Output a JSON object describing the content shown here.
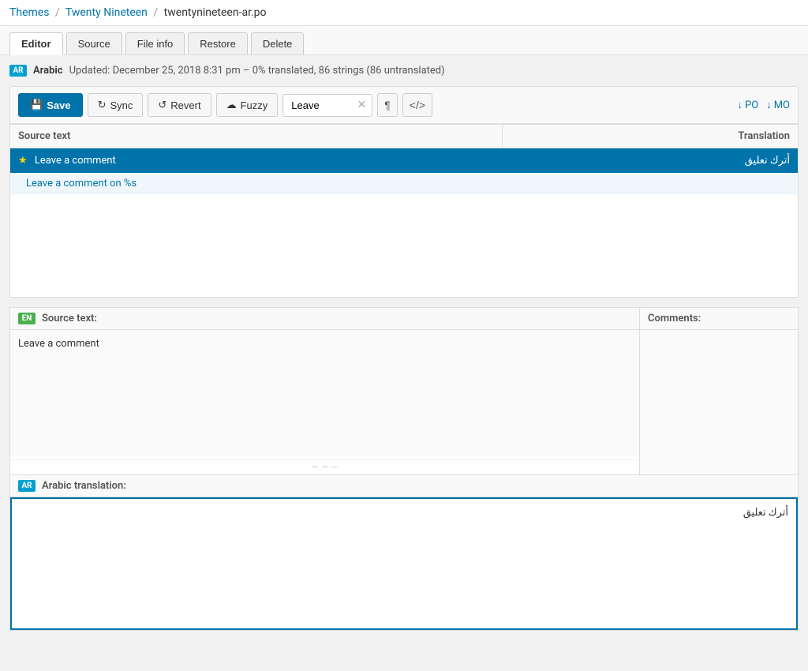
{
  "breadcrumb": {
    "themes_label": "Themes",
    "theme_name": "Twenty Nineteen",
    "file_name": "twentynineteen-ar.po"
  },
  "tabs": [
    {
      "id": "editor",
      "label": "Editor",
      "active": true
    },
    {
      "id": "source",
      "label": "Source",
      "active": false
    },
    {
      "id": "fileinfo",
      "label": "File info",
      "active": false
    },
    {
      "id": "restore",
      "label": "Restore",
      "active": false
    },
    {
      "id": "delete",
      "label": "Delete",
      "active": false
    }
  ],
  "language_status": {
    "badge": "AR",
    "name": "Arabic",
    "info": "Updated: December 25, 2018 8:31 pm – 0% translated, 86 strings (86 untranslated)"
  },
  "toolbar": {
    "save_label": "Save",
    "sync_label": "Sync",
    "revert_label": "Revert",
    "fuzzy_label": "Fuzzy",
    "filter_value": "Leave",
    "filter_placeholder": "Leave",
    "pilcrow_icon": "¶",
    "code_icon": "</>",
    "po_label": "PO",
    "mo_label": "MO",
    "download_icon": "↓"
  },
  "table": {
    "col_source": "Source text",
    "col_translation": "Translation",
    "selected_row": {
      "star": "★",
      "source": "Leave a comment",
      "translation": "أترك تعليق"
    },
    "sub_row": {
      "text": "Leave a comment on %s"
    }
  },
  "source_section": {
    "header_badge": "EN",
    "header_label": "Source text:",
    "value": "Leave a comment",
    "comments_label": "Comments:"
  },
  "arabic_section": {
    "header_badge": "AR",
    "header_label": "Arabic translation:",
    "value": "أترك تعليق"
  }
}
